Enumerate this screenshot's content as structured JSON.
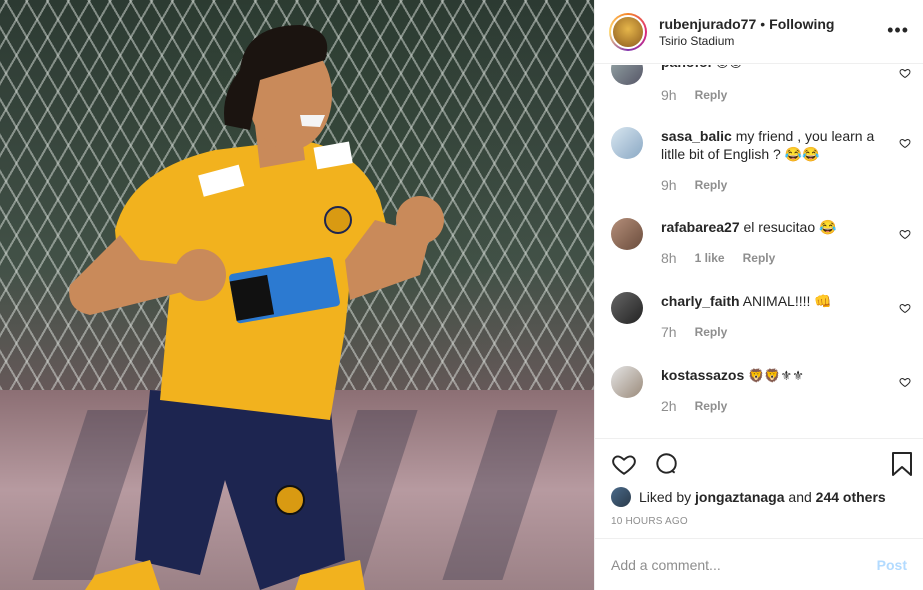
{
  "header": {
    "username": "rubenjurado77",
    "separator": "•",
    "follow_status": "Following",
    "location": "Tsirio Stadium",
    "more_icon": "more-horizontal-icon"
  },
  "comments": [
    {
      "user": "panofol",
      "text": "😊😊",
      "time": "9h",
      "likes": "",
      "reply": "Reply"
    },
    {
      "user": "sasa_balic",
      "text": "my friend , you learn a litlle bit of English ? 😂😂",
      "time": "9h",
      "likes": "",
      "reply": "Reply"
    },
    {
      "user": "rafabarea27",
      "text": "el resucitao 😂",
      "time": "8h",
      "likes": "1 like",
      "reply": "Reply"
    },
    {
      "user": "charly_faith",
      "text": "ANIMAL!!!! 👊",
      "time": "7h",
      "likes": "",
      "reply": "Reply"
    },
    {
      "user": "kostassazos",
      "text": "🦁🦁⚜⚜",
      "time": "2h",
      "likes": "",
      "reply": "Reply"
    }
  ],
  "actions": {
    "liked_by_prefix": "Liked by",
    "liked_by_user": "jongaztanaga",
    "and": "and",
    "others": "244 others",
    "posted_ago": "10 HOURS AGO"
  },
  "add_comment": {
    "placeholder": "Add a comment...",
    "post_label": "Post"
  },
  "colors": {
    "jersey": "#f2b21e",
    "shorts": "#1d2550",
    "post_button_disabled": "#b3dbff",
    "muted_text": "#8e8e8e"
  }
}
